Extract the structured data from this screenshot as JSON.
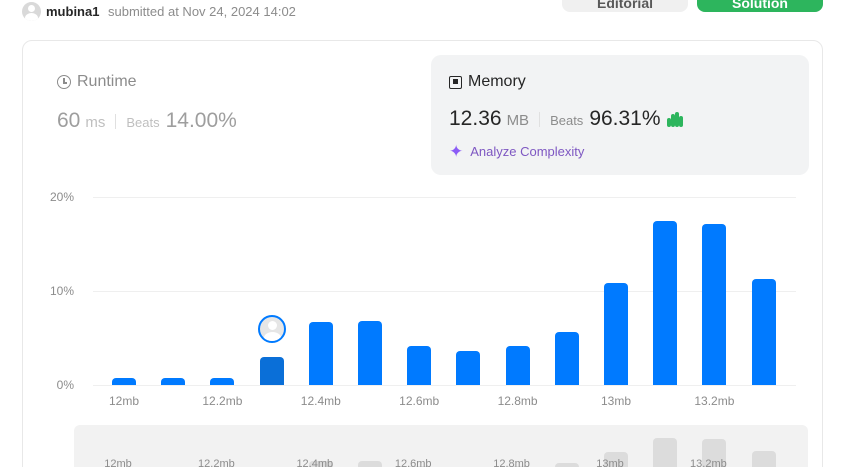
{
  "header": {
    "username": "mubina1",
    "submitted_text": "submitted at Nov 24, 2024 14:02",
    "editorial_label": "Editorial",
    "solution_label": "Solution"
  },
  "runtime": {
    "title": "Runtime",
    "value": "60",
    "unit": "ms",
    "beats_label": "Beats",
    "beats_pct": "14.00%"
  },
  "memory": {
    "title": "Memory",
    "value": "12.36",
    "unit": "MB",
    "beats_label": "Beats",
    "beats_pct": "96.31%",
    "analyze_label": "Analyze Complexity"
  },
  "colors": {
    "accent": "#007aff",
    "solution_green": "#2db55d",
    "analyze_purple": "#7e57c2"
  },
  "chart_data": {
    "type": "bar",
    "title": "",
    "xlabel": "",
    "ylabel": "",
    "y_ticks": [
      "20%",
      "10%",
      "0%"
    ],
    "ylim": [
      0,
      20
    ],
    "x_tick_labels": [
      "12mb",
      "12.2mb",
      "12.4mb",
      "12.6mb",
      "12.8mb",
      "13mb",
      "13.2mb"
    ],
    "values": [
      0.7,
      0.7,
      0.7,
      3.0,
      6.7,
      6.8,
      4.2,
      3.6,
      4.2,
      5.6,
      10.9,
      17.5,
      17.1,
      11.3
    ],
    "highlight_index": 3,
    "grid": true,
    "minimap_labels": [
      "12mb",
      "12.2mb",
      "12.4mb",
      "12.6mb",
      "12.8mb",
      "13mb",
      "13.2mb"
    ]
  }
}
